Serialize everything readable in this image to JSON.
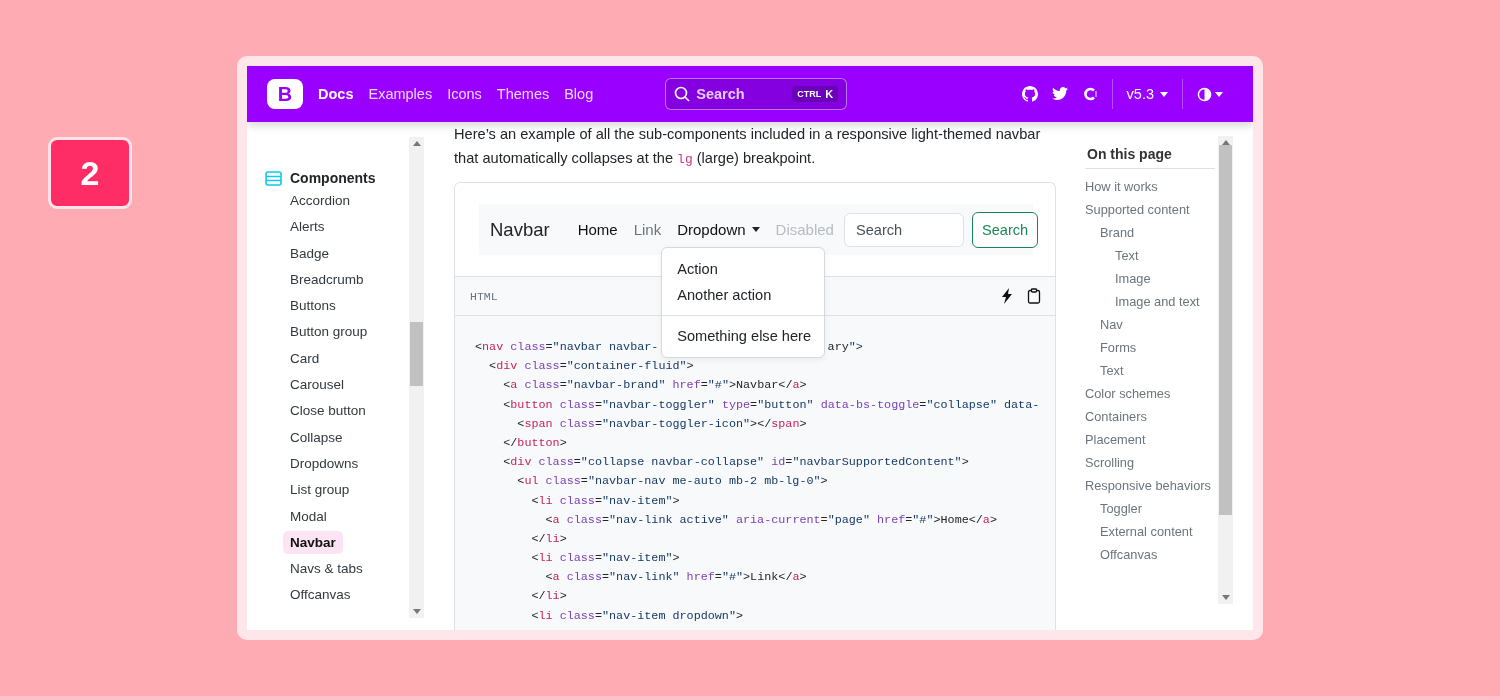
{
  "step_badge": "2",
  "topnav": {
    "logo": "B",
    "links": [
      {
        "label": "Docs",
        "selected": true
      },
      {
        "label": "Examples",
        "selected": false
      },
      {
        "label": "Icons",
        "selected": false
      },
      {
        "label": "Themes",
        "selected": false
      },
      {
        "label": "Blog",
        "selected": false
      }
    ],
    "search": {
      "placeholder": "Search",
      "shortcut": [
        "CTRL",
        "K"
      ]
    },
    "version": "v5.3"
  },
  "sidebar": {
    "section": "Components",
    "items": [
      {
        "label": "Accordion",
        "selected": false
      },
      {
        "label": "Alerts",
        "selected": false
      },
      {
        "label": "Badge",
        "selected": false
      },
      {
        "label": "Breadcrumb",
        "selected": false
      },
      {
        "label": "Buttons",
        "selected": false
      },
      {
        "label": "Button group",
        "selected": false
      },
      {
        "label": "Card",
        "selected": false
      },
      {
        "label": "Carousel",
        "selected": false
      },
      {
        "label": "Close button",
        "selected": false
      },
      {
        "label": "Collapse",
        "selected": false
      },
      {
        "label": "Dropdowns",
        "selected": false
      },
      {
        "label": "List group",
        "selected": false
      },
      {
        "label": "Modal",
        "selected": false
      },
      {
        "label": "Navbar",
        "selected": true
      },
      {
        "label": "Navs & tabs",
        "selected": false
      },
      {
        "label": "Offcanvas",
        "selected": false
      }
    ]
  },
  "main": {
    "intro": {
      "before": "Here’s an example of all the sub-components included in a responsive light-themed navbar that automatically collapses at the ",
      "code": "lg",
      "after": " (large) breakpoint."
    },
    "example_navbar": {
      "brand": "Navbar",
      "links": [
        {
          "label": "Home",
          "kind": "active"
        },
        {
          "label": "Link",
          "kind": "link"
        },
        {
          "label": "Dropdown",
          "kind": "dropdown",
          "expanded": true
        },
        {
          "label": "Disabled",
          "kind": "disabled"
        }
      ],
      "dropdown_menu": [
        {
          "kind": "item",
          "label": "Action"
        },
        {
          "kind": "item",
          "label": "Another action"
        },
        {
          "kind": "divider"
        },
        {
          "kind": "item",
          "label": "Something else here"
        }
      ],
      "search": {
        "placeholder": "Search"
      },
      "search_button": "Search"
    },
    "code_header": {
      "language": "HTML"
    },
    "code_lines": [
      [
        "<nav class=\"navbar navbar-",
        "ary\">"
      ],
      [
        "  <div class=\"container-fluid\">"
      ],
      [
        "    <a class=\"navbar-brand\" href=\"#\">Navbar</a>"
      ],
      [
        "    <button class=\"navbar-toggler\" type=\"button\" data-bs-toggle=\"collapse\" data-"
      ],
      [
        "      <span class=\"navbar-toggler-icon\"></span>"
      ],
      [
        "    </button>"
      ],
      [
        "    <div class=\"collapse navbar-collapse\" id=\"navbarSupportedContent\">"
      ],
      [
        "      <ul class=\"navbar-nav me-auto mb-2 mb-lg-0\">"
      ],
      [
        "        <li class=\"nav-item\">"
      ],
      [
        "          <a class=\"nav-link active\" aria-current=\"page\" href=\"#\">Home</a>"
      ],
      [
        "        </li>"
      ],
      [
        "        <li class=\"nav-item\">"
      ],
      [
        "          <a class=\"nav-link\" href=\"#\">Link</a>"
      ],
      [
        "        </li>"
      ],
      [
        "        <li class=\"nav-item dropdown\">"
      ]
    ]
  },
  "toc": {
    "title": "On this page",
    "items": [
      {
        "label": "How it works"
      },
      {
        "label": "Supported content",
        "children": [
          {
            "label": "Brand",
            "children": [
              {
                "label": "Text"
              },
              {
                "label": "Image"
              },
              {
                "label": "Image and text"
              }
            ]
          },
          {
            "label": "Nav"
          },
          {
            "label": "Forms"
          },
          {
            "label": "Text"
          }
        ]
      },
      {
        "label": "Color schemes"
      },
      {
        "label": "Containers"
      },
      {
        "label": "Placement"
      },
      {
        "label": "Scrolling"
      },
      {
        "label": "Responsive behaviors",
        "children": [
          {
            "label": "Toggler"
          },
          {
            "label": "External content"
          },
          {
            "label": "Offcanvas"
          }
        ]
      }
    ]
  }
}
